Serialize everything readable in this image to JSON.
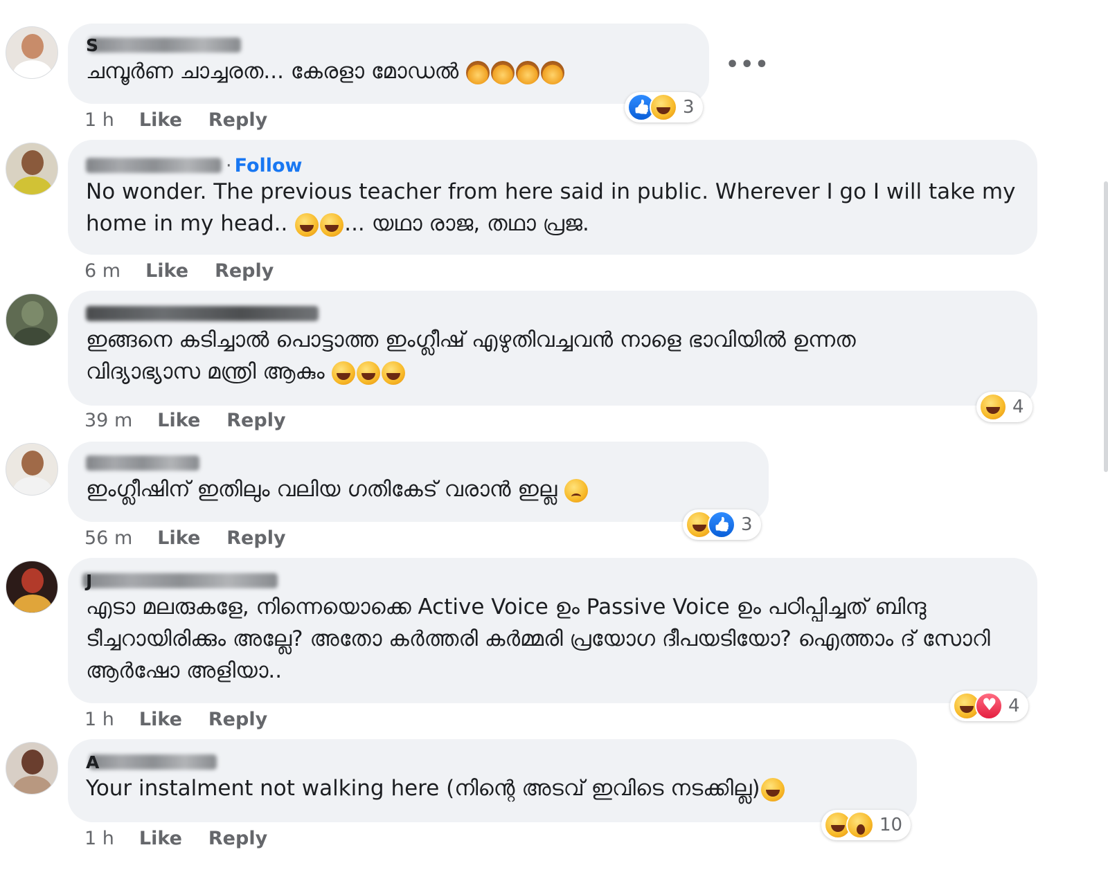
{
  "more_label": "•••",
  "comments": [
    {
      "initial": "S",
      "text": "ചമ്പൂർണ ചാച്ചരത... കേരളാ മോഡൽ",
      "time": "1 h",
      "like": "Like",
      "reply": "Reply",
      "reaction_count": "3"
    },
    {
      "initial": "",
      "follow": "Follow",
      "follow_sep": "·",
      "text_a": "No wonder. The previous teacher from here said in public. Wherever I go I will take my home in my head..",
      "text_b": "... യഥാ രാജ, തഥാ പ്രജ.",
      "time": "6 m",
      "like": "Like",
      "reply": "Reply"
    },
    {
      "initial": "",
      "text": "ഇങ്ങനെ കടിച്ചാൽ പൊട്ടാത്ത ഇംഗ്ലീഷ് എഴുതിവച്ചവൻ നാളെ ഭാവിയിൽ ഉന്നത വിദ്യാഭ്യാസ മന്ത്രി ആകും",
      "time": "39 m",
      "like": "Like",
      "reply": "Reply",
      "reaction_count": "4"
    },
    {
      "initial": "",
      "text": "ഇംഗ്ലീഷിന് ഇതിലും വലിയ ഗതികേട് വരാൻ ഇല്ല",
      "time": "56 m",
      "like": "Like",
      "reply": "Reply",
      "reaction_count": "3"
    },
    {
      "initial": "J",
      "text": "എടാ മലരുകളേ, നിന്നെയൊക്കെ Active Voice ഉം Passive Voice ഉം പഠിപ്പിച്ചത് ബിന്ദു ടീച്ചറായിരിക്കും അല്ലേ? അതോ കർത്തരി കർമ്മരി പ്രയോഗ ദീപയടിയോ? ഐത്താം ദ് സോറി ആർഷോ അളിയാ..",
      "time": "1 h",
      "like": "Like",
      "reply": "Reply",
      "reaction_count": "4"
    },
    {
      "initial": "A",
      "text": "Your instalment not walking here (നിന്റെ അടവ് ഇവിടെ നടക്കില്ല)",
      "time": "1 h",
      "like": "Like",
      "reply": "Reply",
      "reaction_count": "10"
    }
  ]
}
